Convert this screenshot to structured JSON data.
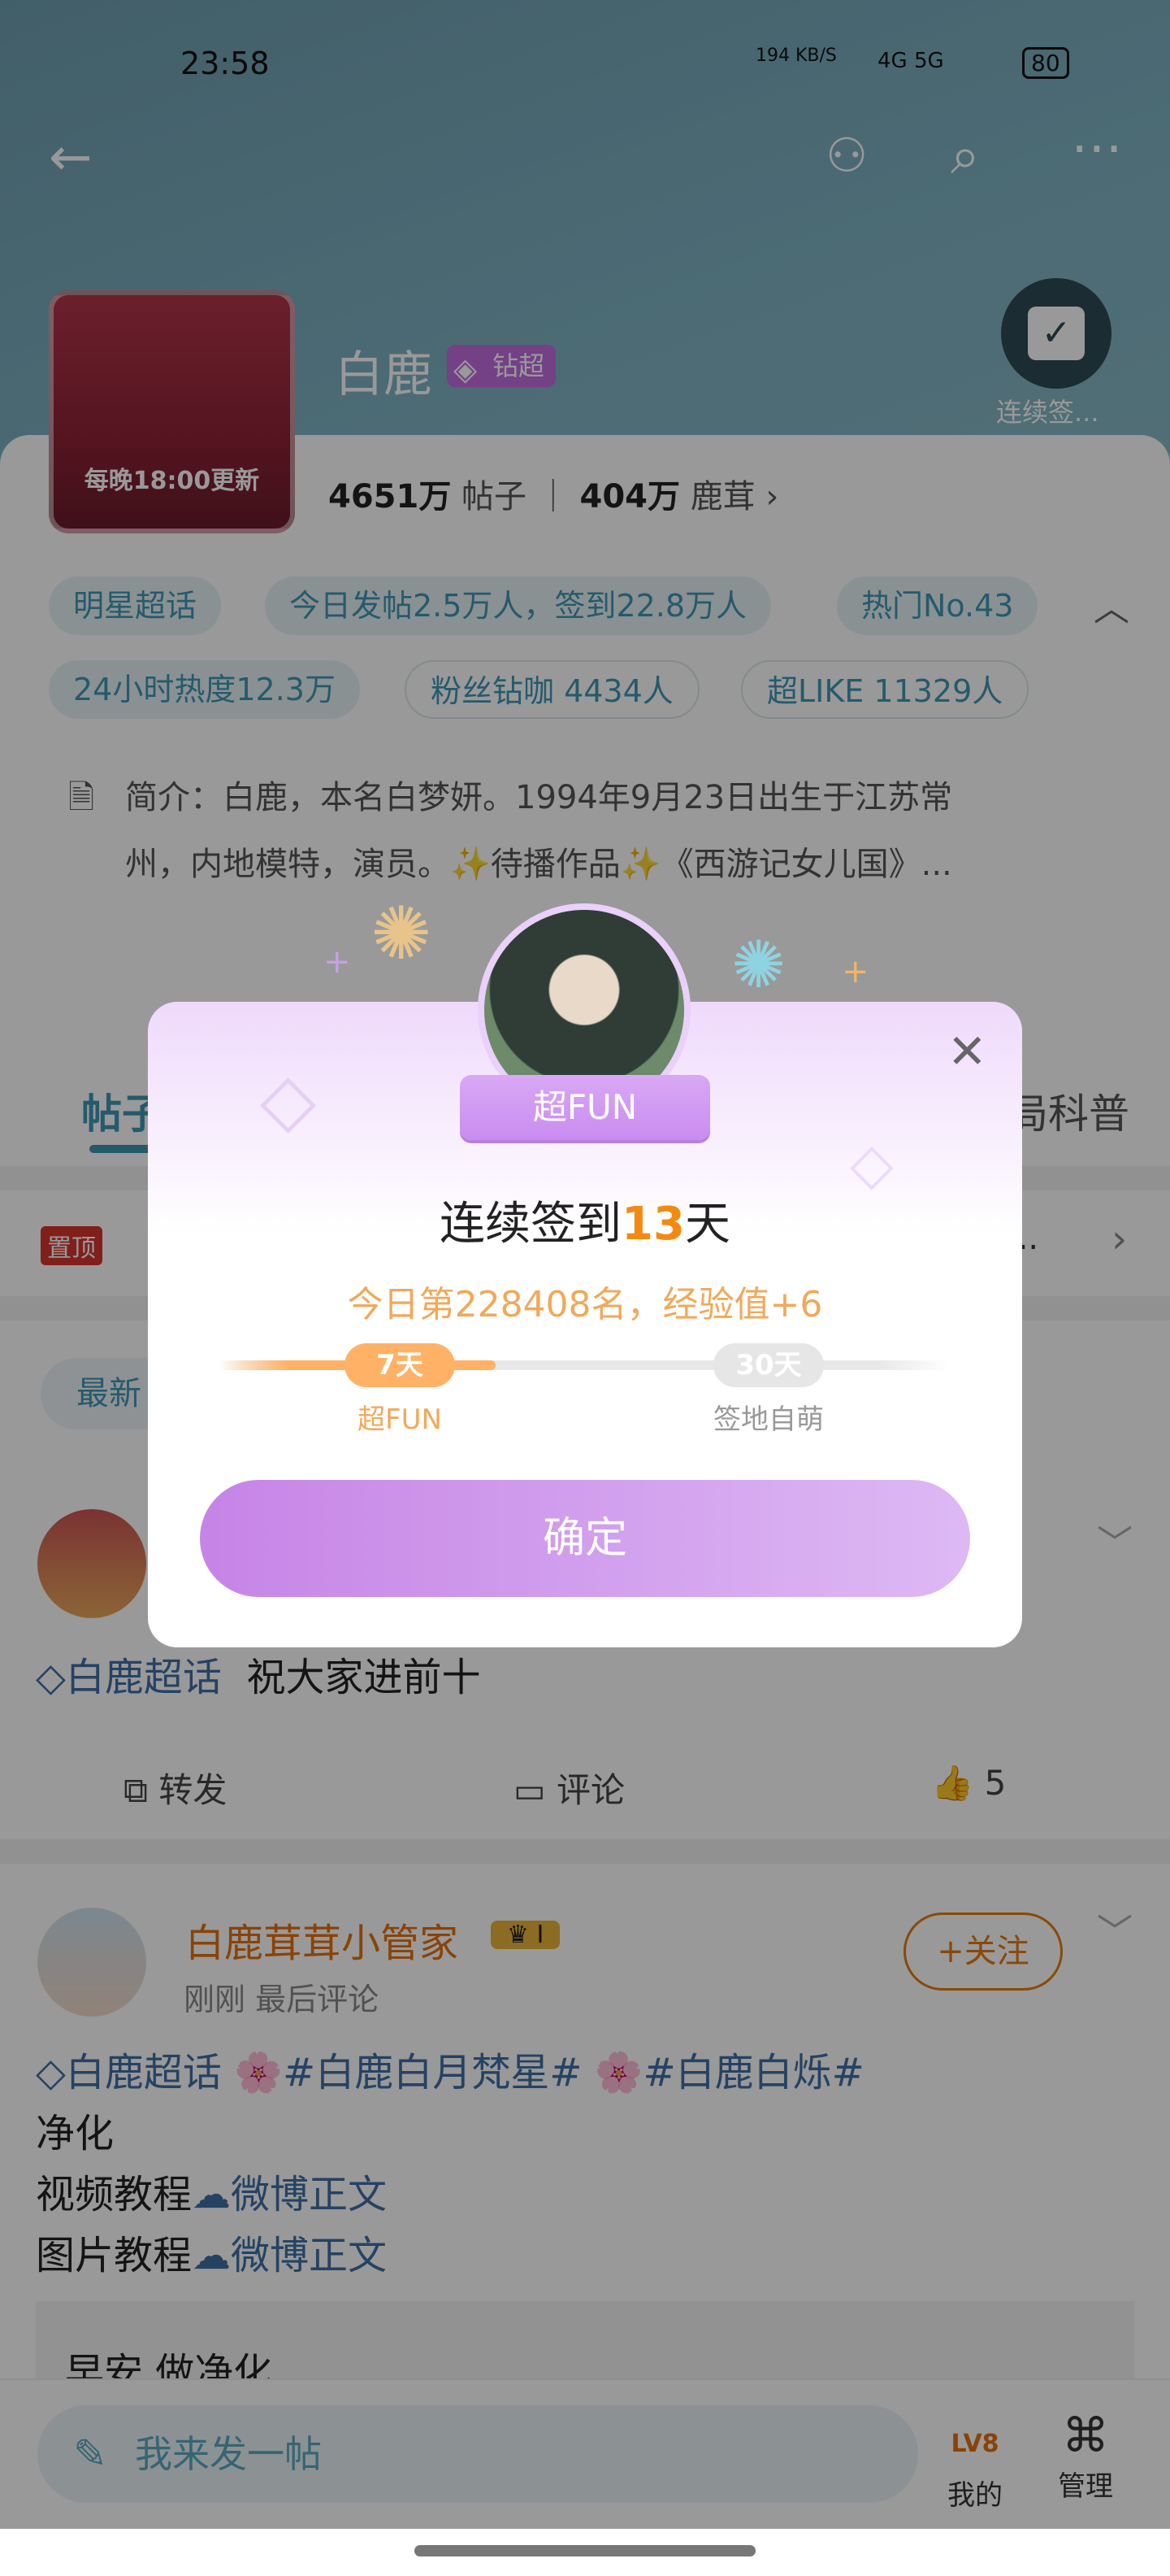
{
  "status_bar": {
    "time": "23:58",
    "net_speed": "194 KB/S",
    "signal": "4G 5G",
    "battery": "80"
  },
  "topic": {
    "title": "白鹿",
    "badge": "钻超",
    "cover_text": "每晚18:00更新",
    "checkin_label": "连续签...",
    "stats": {
      "posts_value": "4651万",
      "posts_label": "帖子",
      "fans_value": "404万",
      "fans_label": "鹿茸"
    },
    "tags": [
      "明星超话",
      "今日发帖2.5万人，签到22.8万人",
      "热门No.43",
      "24小时热度12.3万",
      "粉丝钻咖 4434人",
      "超LIKE 11329人"
    ],
    "intro_line1": "简介：白鹿，本名白梦妍。1994年9月23日出生于江苏常",
    "intro_line2": "州，内地模特，演员。✨待播作品✨《西游记女儿国》..."
  },
  "tabs": {
    "first": "帖子",
    "last": "局科普"
  },
  "pinned": {
    "tag": "置顶",
    "text_tail": "..."
  },
  "filter": {
    "latest": "最新"
  },
  "post1": {
    "text_topic": "白鹿超话",
    "text": "祝大家进前十",
    "repost": "转发",
    "comment": "评论",
    "like_count": "5"
  },
  "post2": {
    "author": "白鹿茸茸小管家",
    "level_badge": "I",
    "meta": "刚刚 最后评论",
    "follow": "+关注",
    "line1_topic": "白鹿超话",
    "line1_tag1": "#白鹿白月梵星#",
    "line1_tag2": "#白鹿白烁#",
    "line2": "净化",
    "line3_text": "视频教程",
    "line3_link": "微博正文",
    "line4_text": "图片教程",
    "line4_link": "微博正文",
    "quote": "早安  做净化"
  },
  "bottom_bar": {
    "compose_placeholder": "我来发一帖",
    "mine": "我的",
    "mine_level": "LV8",
    "manage": "管理"
  },
  "modal": {
    "ribbon": "超FUN",
    "title_prefix": "连续签到",
    "title_days": "13",
    "title_suffix": "天",
    "subtitle": "今日第228408名，经验值+6",
    "milestones": [
      {
        "days": "7天",
        "label": "超FUN",
        "reached": true
      },
      {
        "days": "30天",
        "label": "签地自萌",
        "reached": false
      }
    ],
    "progress_days": 13,
    "confirm": "确定"
  },
  "colors": {
    "accent": "#3e96b5",
    "orange": "#f28a12",
    "purple": "#c684e6",
    "link": "#3f6fa6"
  }
}
